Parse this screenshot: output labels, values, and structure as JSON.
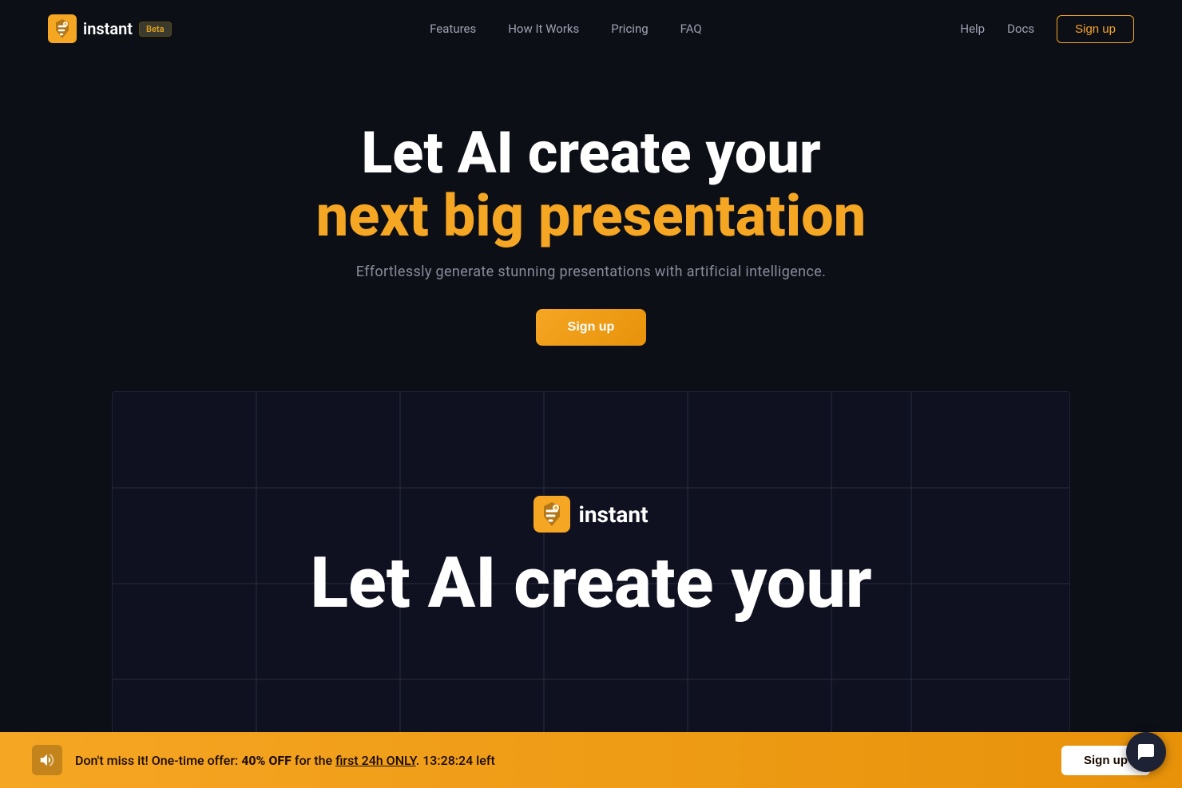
{
  "brand": {
    "name": "instant",
    "beta_label": "Beta",
    "logo_alt": "Instant logo"
  },
  "nav": {
    "links": [
      {
        "label": "Features",
        "id": "features"
      },
      {
        "label": "How It Works",
        "id": "how-it-works"
      },
      {
        "label": "Pricing",
        "id": "pricing"
      },
      {
        "label": "FAQ",
        "id": "faq"
      }
    ],
    "right_links": [
      {
        "label": "Help"
      },
      {
        "label": "Docs"
      }
    ],
    "signup_label": "Sign up"
  },
  "hero": {
    "title_line1": "Let AI create your",
    "title_line2": "next big presentation",
    "subtitle": "Effortlessly generate stunning presentations with artificial intelligence.",
    "signup_label": "Sign up"
  },
  "grid_section": {
    "inner_logo_text": "instant",
    "inner_title": "Let AI create your"
  },
  "banner": {
    "text_prefix": "Don't miss it! One-time offer: ",
    "discount": "40% OFF",
    "text_mid": " for the ",
    "highlight": "first 24h ONLY",
    "timer": ". 13:28:24 left",
    "signup_label": "Sign up"
  },
  "chat_button": {
    "icon": "💬"
  }
}
